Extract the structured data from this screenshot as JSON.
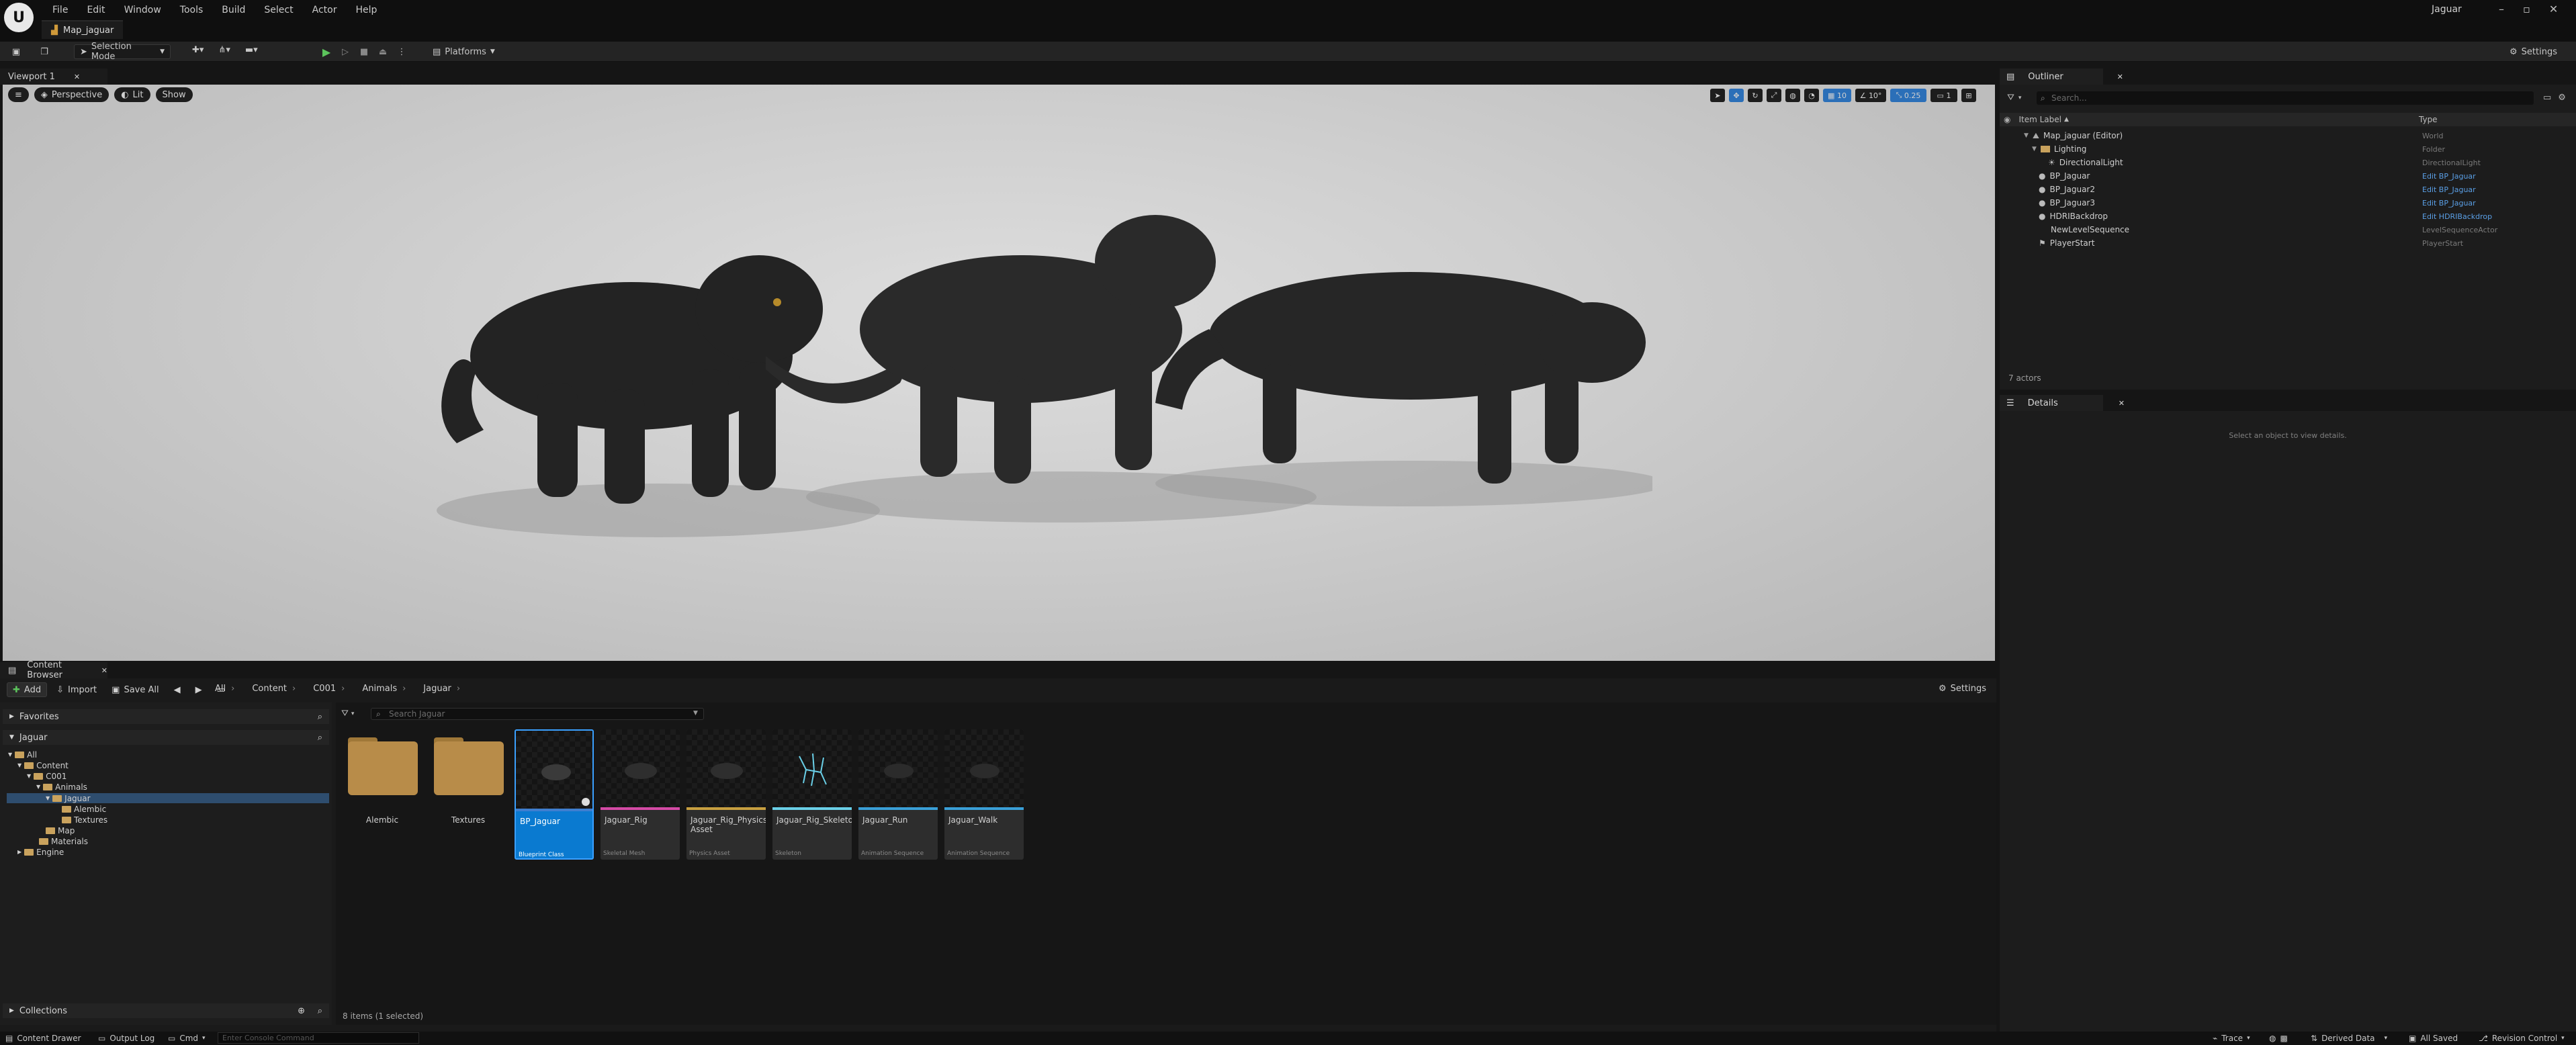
{
  "titlebar": {
    "menus": [
      "File",
      "Edit",
      "Window",
      "Tools",
      "Build",
      "Select",
      "Actor",
      "Help"
    ],
    "map_tab": "Map_jaguar",
    "project_name": "Jaguar"
  },
  "toolbar": {
    "selection_mode": "Selection Mode",
    "platforms": "Platforms",
    "settings": "Settings"
  },
  "viewport": {
    "tab": "Viewport 1",
    "perspective": "Perspective",
    "lit": "Lit",
    "show": "Show",
    "grid_snap": "10",
    "rotation_snap": "10°",
    "scale_snap": "0.25",
    "camera_speed": "1"
  },
  "outliner": {
    "tab": "Outliner",
    "search_placeholder": "Search...",
    "col_label": "Item Label",
    "col_type": "Type",
    "rows": [
      {
        "label": "Map_jaguar (Editor)",
        "type": "World"
      },
      {
        "label": "Lighting",
        "type": "Folder"
      },
      {
        "label": "DirectionalLight",
        "type": "DirectionalLight"
      },
      {
        "label": "BP_Jaguar",
        "type": "Edit BP_Jaguar"
      },
      {
        "label": "BP_Jaguar2",
        "type": "Edit BP_Jaguar"
      },
      {
        "label": "BP_Jaguar3",
        "type": "Edit BP_Jaguar"
      },
      {
        "label": "HDRIBackdrop",
        "type": "Edit HDRIBackdrop"
      },
      {
        "label": "NewLevelSequence",
        "type": "LevelSequenceActor"
      },
      {
        "label": "PlayerStart",
        "type": "PlayerStart"
      }
    ],
    "actor_count": "7 actors"
  },
  "details": {
    "tab": "Details",
    "empty_message": "Select an object to view details."
  },
  "content_browser": {
    "tab": "Content Browser",
    "add": "Add",
    "import": "Import",
    "save_all": "Save All",
    "breadcrumb": [
      "All",
      "Content",
      "C001",
      "Animals",
      "Jaguar"
    ],
    "settings": "Settings",
    "favorites": "Favorites",
    "root": "Jaguar",
    "tree": [
      "All",
      "Content",
      "C001",
      "Animals",
      "Jaguar",
      "Alembic",
      "Textures",
      "Map",
      "Materials",
      "Engine"
    ],
    "search_placeholder": "Search Jaguar",
    "folders": [
      "Alembic",
      "Textures"
    ],
    "assets": [
      {
        "name": "BP_Jaguar",
        "type": "Blueprint Class"
      },
      {
        "name": "Jaguar_Rig",
        "type": "Skeletal Mesh"
      },
      {
        "name": "Jaguar_Rig_Physics Asset",
        "type": "Physics Asset"
      },
      {
        "name": "Jaguar_Rig_Skeleton",
        "type": "Skeleton"
      },
      {
        "name": "Jaguar_Run",
        "type": "Animation Sequence"
      },
      {
        "name": "Jaguar_Walk",
        "type": "Animation Sequence"
      }
    ],
    "collections": "Collections",
    "item_count": "8 items (1 selected)"
  },
  "statusbar": {
    "content_drawer": "Content Drawer",
    "output_log": "Output Log",
    "cmd": "Cmd",
    "console_placeholder": "Enter Console Command",
    "trace": "Trace",
    "derived_data": "Derived Data",
    "all_saved": "All Saved",
    "revision_control": "Revision Control"
  },
  "colors": {
    "accent": "#0a7ad0",
    "link": "#5a9fe6",
    "folder": "#c9a25d"
  }
}
